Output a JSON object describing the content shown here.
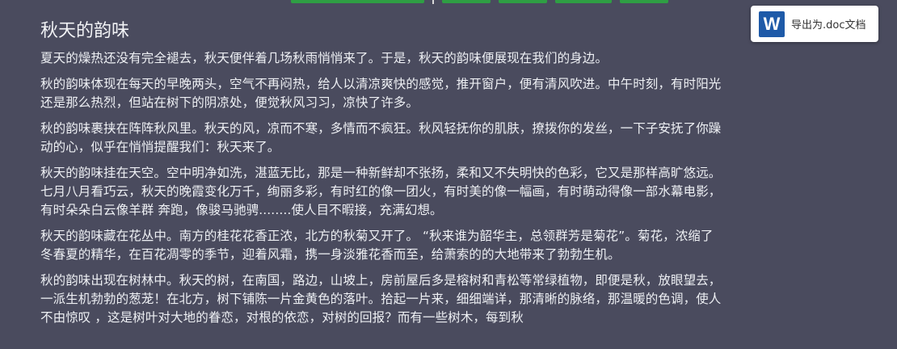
{
  "article": {
    "title": "秋天的韵味",
    "paragraphs": [
      "夏天的燥热还没有完全褪去，秋天便伴着几场秋雨悄悄来了。于是，秋天的韵味便展现在我们的身边。",
      "秋的韵味体现在每天的早晚两头，空气不再闷热，给人以清凉爽快的感觉，推开窗户，便有清风吹进。中午时刻，有时阳光还是那么热烈，但站在树下的阴凉处，便觉秋风习习，凉快了许多。",
      "秋的韵味裹挟在阵阵秋风里。秋天的风，凉而不寒，多情而不疯狂。秋风轻抚你的肌肤，撩拨你的发丝，一下子安抚了你躁动的心，似乎在悄悄提醒我们：秋天来了。",
      "秋天的韵味挂在天空。空中明净如洗，湛蓝无比，那是一种新鲜却不张扬，柔和又不失明快的色彩，它又是那样高旷悠远。 七月八月看巧云，秋天的晚霞变化万千，绚丽多彩，有时红的像一团火，有时美的像一幅画，有时萌动得像一部水幕电影，有时朵朵白云像羊群 奔跑，像骏马驰骋........使人目不暇接，充满幻想。",
      "秋天的韵味藏在花丛中。南方的桂花花香正浓，北方的秋菊又开了。 “秋来谁为韶华主，总领群芳是菊花”。菊花，浓缩了冬春夏的精华，在百花凋零的季节，迎着风霜，携一身淡雅花香而至，给萧索的的大地带来了勃勃生机。",
      "秋的韵味出现在树林中。秋天的树，在南国，路边，山坡上，房前屋后多是榕树和青松等常绿植物，即便是秋，放眼望去，一派生机勃勃的葱茏！在北方，树下铺陈一片金黄色的落叶。拾起一片来，细细端详，那清晰的脉络，那温暖的色调，使人不由惊叹 ，这是树叶对大地的眷恋，对根的依恋，对树的回报？而有一些树木，每到秋"
    ]
  },
  "export": {
    "icon_letter": "W",
    "label": "导出为.doc文档"
  },
  "colors": {
    "background": "#4a4b5e",
    "text": "#eef0f4",
    "accent_green": "#2f9e44",
    "word_blue": "#1e5aa8"
  }
}
